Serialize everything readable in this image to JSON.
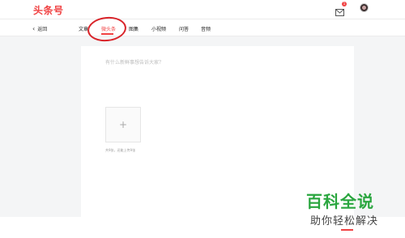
{
  "header": {
    "logo": "头条号",
    "notification_count": "1"
  },
  "nav": {
    "back_label": "返回",
    "tabs": [
      {
        "label": "文章",
        "active": false
      },
      {
        "label": "微头条",
        "active": true
      },
      {
        "label": "图集",
        "active": false
      },
      {
        "label": "小视频",
        "active": false
      },
      {
        "label": "问答",
        "active": false
      },
      {
        "label": "音频",
        "active": false
      }
    ]
  },
  "editor": {
    "placeholder": "有什么新鲜事想告诉大家？",
    "upload_hint": "共9张，还能上传9张"
  },
  "watermark": {
    "title": "百科全说",
    "subtitle": "助你轻松解决"
  },
  "colors": {
    "accent": "#f04142",
    "annotation": "#d9242a",
    "watermark_green": "#2aa63f"
  }
}
